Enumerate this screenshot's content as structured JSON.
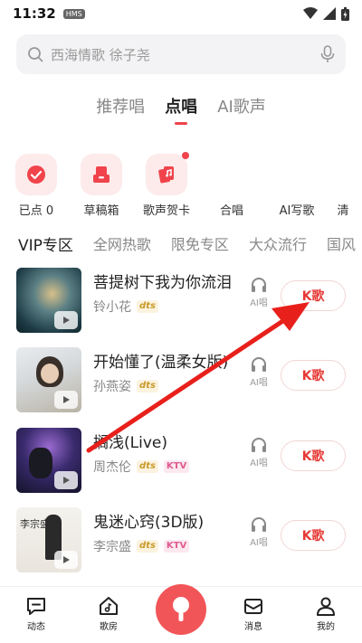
{
  "status": {
    "time": "11:32",
    "badge": "HMS"
  },
  "search": {
    "placeholder": "西海情歌 徐子尧"
  },
  "tabs": [
    "推荐唱",
    "点唱",
    "AI歌声"
  ],
  "quick": {
    "items": [
      {
        "label": "已点 0",
        "icon": "check-circle-icon"
      },
      {
        "label": "草稿箱",
        "icon": "draft-box-icon"
      },
      {
        "label": "歌声贺卡",
        "icon": "greeting-card-icon"
      },
      {
        "label": "合唱"
      },
      {
        "label": "AI写歌"
      },
      {
        "label": "清"
      }
    ]
  },
  "categories": [
    "VIP专区",
    "全网热歌",
    "限免专区",
    "大众流行",
    "国风"
  ],
  "songs": [
    {
      "title": "菩提树下我为你流泪",
      "singer": "铃小花",
      "tags": [
        "dts"
      ]
    },
    {
      "title": "开始懂了(温柔女版)",
      "singer": "孙燕姿",
      "tags": [
        "dts"
      ]
    },
    {
      "title": "搁浅(Live)",
      "singer": "周杰伦",
      "tags": [
        "dts",
        "KTV"
      ]
    },
    {
      "title": "鬼迷心窍(3D版)",
      "singer": "李宗盛",
      "tags": [
        "dts",
        "KTV"
      ]
    }
  ],
  "song_actions": {
    "ai_label": "AI唱",
    "k_label": "K歌"
  },
  "cover_texts": {
    "song4": "李宗盛"
  },
  "nav": [
    "动态",
    "歌房",
    "消息",
    "我的"
  ],
  "colors": {
    "accent": "#f0434b",
    "k_text": "#e53935",
    "arrow": "#e8201c"
  }
}
